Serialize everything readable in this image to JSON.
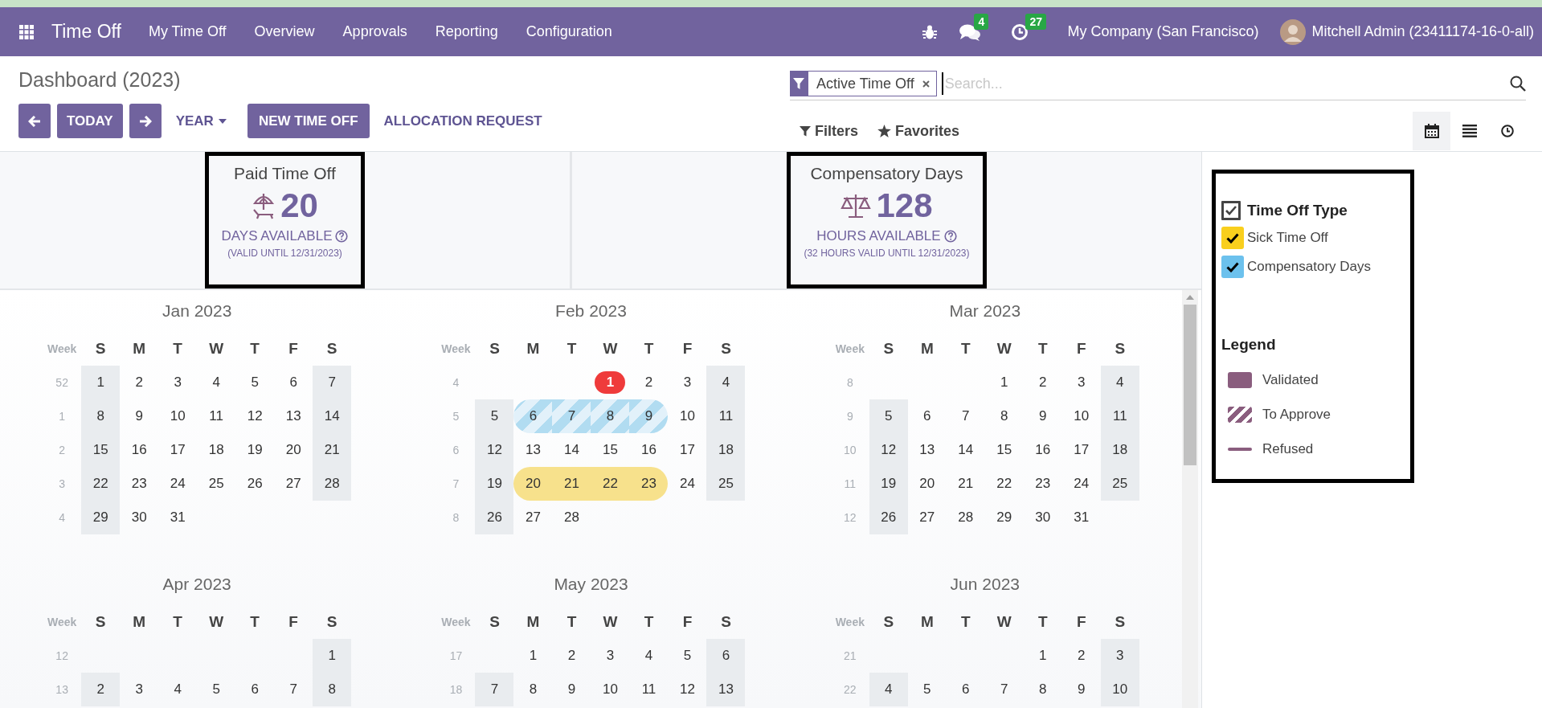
{
  "topbar": {
    "app_name": "Time Off",
    "menu": [
      "My Time Off",
      "Overview",
      "Approvals",
      "Reporting",
      "Configuration"
    ],
    "messages_badge": "4",
    "activities_badge": "27",
    "company": "My Company (San Francisco)",
    "user": "Mitchell Admin (23411174-16-0-all)"
  },
  "control_panel": {
    "title": "Dashboard (2023)",
    "buttons": [
      {
        "kind": "prev"
      },
      {
        "kind": "button",
        "label": "TODAY"
      },
      {
        "kind": "next"
      },
      {
        "kind": "dropdown",
        "label": "YEAR"
      },
      {
        "kind": "primary",
        "label": "NEW TIME OFF"
      },
      {
        "kind": "link",
        "label": "ALLOCATION REQUEST"
      }
    ],
    "search": {
      "facet": "Active Time Off",
      "placeholder": "Search..."
    },
    "filters": "Filters",
    "favorites": "Favorites",
    "views": [
      {
        "kind": "calendar",
        "selected": true
      },
      {
        "kind": "list",
        "selected": false
      },
      {
        "kind": "activity",
        "selected": false
      }
    ]
  },
  "summaries": [
    {
      "title": "Paid Time Off",
      "kind": "days",
      "amount": "20",
      "unit": "DAYS AVAILABLE",
      "note": "(VALID UNTIL 12/31/2023)"
    },
    {
      "title": "Compensatory Days",
      "kind": "hours",
      "amount": "128",
      "unit": "HOURS AVAILABLE",
      "note": "(32 HOURS VALID UNTIL 12/31/2023)"
    }
  ],
  "calendar": {
    "months": [
      {
        "title": "Jan 2023",
        "week_label": "Week",
        "weekdays": [
          "S",
          "M",
          "T",
          "W",
          "T",
          "F",
          "S"
        ],
        "weeks": [
          {
            "week": "52",
            "days": [
              "1",
              "2",
              "3",
              "4",
              "5",
              "6",
              "7"
            ]
          },
          {
            "week": "1",
            "days": [
              "8",
              "9",
              "10",
              "11",
              "12",
              "13",
              "14"
            ]
          },
          {
            "week": "2",
            "days": [
              "15",
              "16",
              "17",
              "18",
              "19",
              "20",
              "21"
            ]
          },
          {
            "week": "3",
            "days": [
              "22",
              "23",
              "24",
              "25",
              "26",
              "27",
              "28"
            ]
          },
          {
            "week": "4",
            "days": [
              "29",
              "30",
              "31",
              {
                "kind": "blank"
              },
              {
                "kind": "blank"
              },
              {
                "kind": "blank"
              },
              {
                "kind": "blank"
              }
            ]
          }
        ]
      },
      {
        "title": "Feb 2023",
        "week_label": "Week",
        "weekdays": [
          "S",
          "M",
          "T",
          "W",
          "T",
          "F",
          "S"
        ],
        "weeks": [
          {
            "week": "4",
            "days": [
              {
                "kind": "blank"
              },
              {
                "kind": "blank"
              },
              {
                "kind": "blank"
              },
              {
                "day": "1",
                "kind": "today"
              },
              "2",
              "3",
              "4"
            ]
          },
          {
            "week": "5",
            "days": [
              "5",
              {
                "day": "6",
                "kind": "to_approve",
                "color": "#b1dcf1"
              },
              {
                "day": "7",
                "kind": "to_approve",
                "color": "#b1dcf1"
              },
              {
                "day": "8",
                "kind": "to_approve",
                "color": "#b1dcf1"
              },
              {
                "day": "9",
                "kind": "to_approve",
                "color": "#b1dcf1"
              },
              "10",
              "11"
            ]
          },
          {
            "week": "6",
            "days": [
              "12",
              "13",
              "14",
              "15",
              "16",
              "17",
              "18"
            ]
          },
          {
            "week": "7",
            "days": [
              "19",
              {
                "day": "20",
                "kind": "validated",
                "color": "#f7e18c"
              },
              {
                "day": "21",
                "kind": "validated",
                "color": "#f7e18c"
              },
              {
                "day": "22",
                "kind": "validated",
                "color": "#f7e18c"
              },
              {
                "day": "23",
                "kind": "validated",
                "color": "#f7e18c"
              },
              "24",
              "25"
            ]
          },
          {
            "week": "8",
            "days": [
              "26",
              "27",
              "28",
              {
                "kind": "blank"
              },
              {
                "kind": "blank"
              },
              {
                "kind": "blank"
              },
              {
                "kind": "blank"
              }
            ]
          }
        ]
      },
      {
        "title": "Mar 2023",
        "week_label": "Week",
        "weekdays": [
          "S",
          "M",
          "T",
          "W",
          "T",
          "F",
          "S"
        ],
        "weeks": [
          {
            "week": "8",
            "days": [
              {
                "kind": "blank"
              },
              {
                "kind": "blank"
              },
              {
                "kind": "blank"
              },
              "1",
              "2",
              "3",
              "4"
            ]
          },
          {
            "week": "9",
            "days": [
              "5",
              "6",
              "7",
              "8",
              "9",
              "10",
              "11"
            ]
          },
          {
            "week": "10",
            "days": [
              "12",
              "13",
              "14",
              "15",
              "16",
              "17",
              "18"
            ]
          },
          {
            "week": "11",
            "days": [
              "19",
              "20",
              "21",
              "22",
              "23",
              "24",
              "25"
            ]
          },
          {
            "week": "12",
            "days": [
              "26",
              "27",
              "28",
              "29",
              "30",
              "31",
              {
                "kind": "blank"
              }
            ]
          }
        ]
      },
      {
        "title": "Apr 2023",
        "week_label": "Week",
        "weekdays": [
          "S",
          "M",
          "T",
          "W",
          "T",
          "F",
          "S"
        ],
        "weeks": [
          {
            "week": "12",
            "days": [
              {
                "kind": "blank"
              },
              {
                "kind": "blank"
              },
              {
                "kind": "blank"
              },
              {
                "kind": "blank"
              },
              {
                "kind": "blank"
              },
              {
                "kind": "blank"
              },
              "1"
            ]
          },
          {
            "week": "13",
            "days": [
              "2",
              "3",
              "4",
              "5",
              "6",
              "7",
              "8"
            ]
          }
        ]
      },
      {
        "title": "May 2023",
        "week_label": "Week",
        "weekdays": [
          "S",
          "M",
          "T",
          "W",
          "T",
          "F",
          "S"
        ],
        "weeks": [
          {
            "week": "17",
            "days": [
              {
                "kind": "blank"
              },
              "1",
              "2",
              "3",
              "4",
              "5",
              "6"
            ]
          },
          {
            "week": "18",
            "days": [
              "7",
              "8",
              "9",
              "10",
              "11",
              "12",
              "13"
            ]
          }
        ]
      },
      {
        "title": "Jun 2023",
        "week_label": "Week",
        "weekdays": [
          "S",
          "M",
          "T",
          "W",
          "T",
          "F",
          "S"
        ],
        "weeks": [
          {
            "week": "21",
            "days": [
              {
                "kind": "blank"
              },
              {
                "kind": "blank"
              },
              {
                "kind": "blank"
              },
              {
                "kind": "blank"
              },
              "1",
              "2",
              "3"
            ]
          },
          {
            "week": "22",
            "days": [
              "4",
              "5",
              "6",
              "7",
              "8",
              "9",
              "10"
            ]
          }
        ]
      }
    ]
  },
  "side_panel": {
    "types": {
      "title": "Time Off Type",
      "checked": true,
      "items": [
        {
          "label": "Sick Time Off",
          "color": "#f9cf1d",
          "checked": true
        },
        {
          "label": "Compensatory Days",
          "color": "#6cc1ed",
          "checked": true
        }
      ]
    },
    "legend": {
      "title": "Legend",
      "items": [
        {
          "kind": "validated",
          "label": "Validated"
        },
        {
          "kind": "to_approve",
          "label": "To Approve"
        },
        {
          "kind": "refused",
          "label": "Refused"
        }
      ]
    }
  }
}
